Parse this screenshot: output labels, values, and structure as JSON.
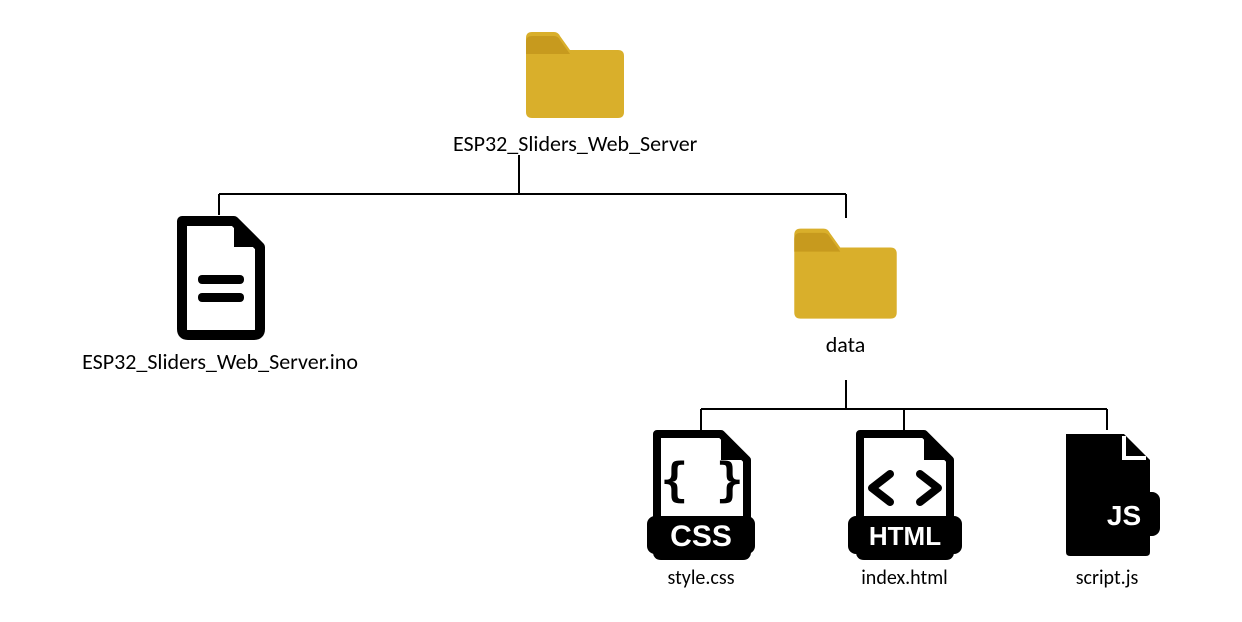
{
  "root": {
    "label": "ESP32_Sliders_Web_Server",
    "icon": "folder",
    "color": "#d9af2b"
  },
  "ino": {
    "label": "ESP32_Sliders_Web_Server.ino",
    "icon": "file-text"
  },
  "dataFolder": {
    "label": "data",
    "icon": "folder",
    "color": "#d9af2b"
  },
  "css": {
    "label": "style.css",
    "badge": "CSS"
  },
  "html": {
    "label": "index.html",
    "badge": "HTML"
  },
  "js": {
    "label": "script.js",
    "badge": "JS"
  }
}
